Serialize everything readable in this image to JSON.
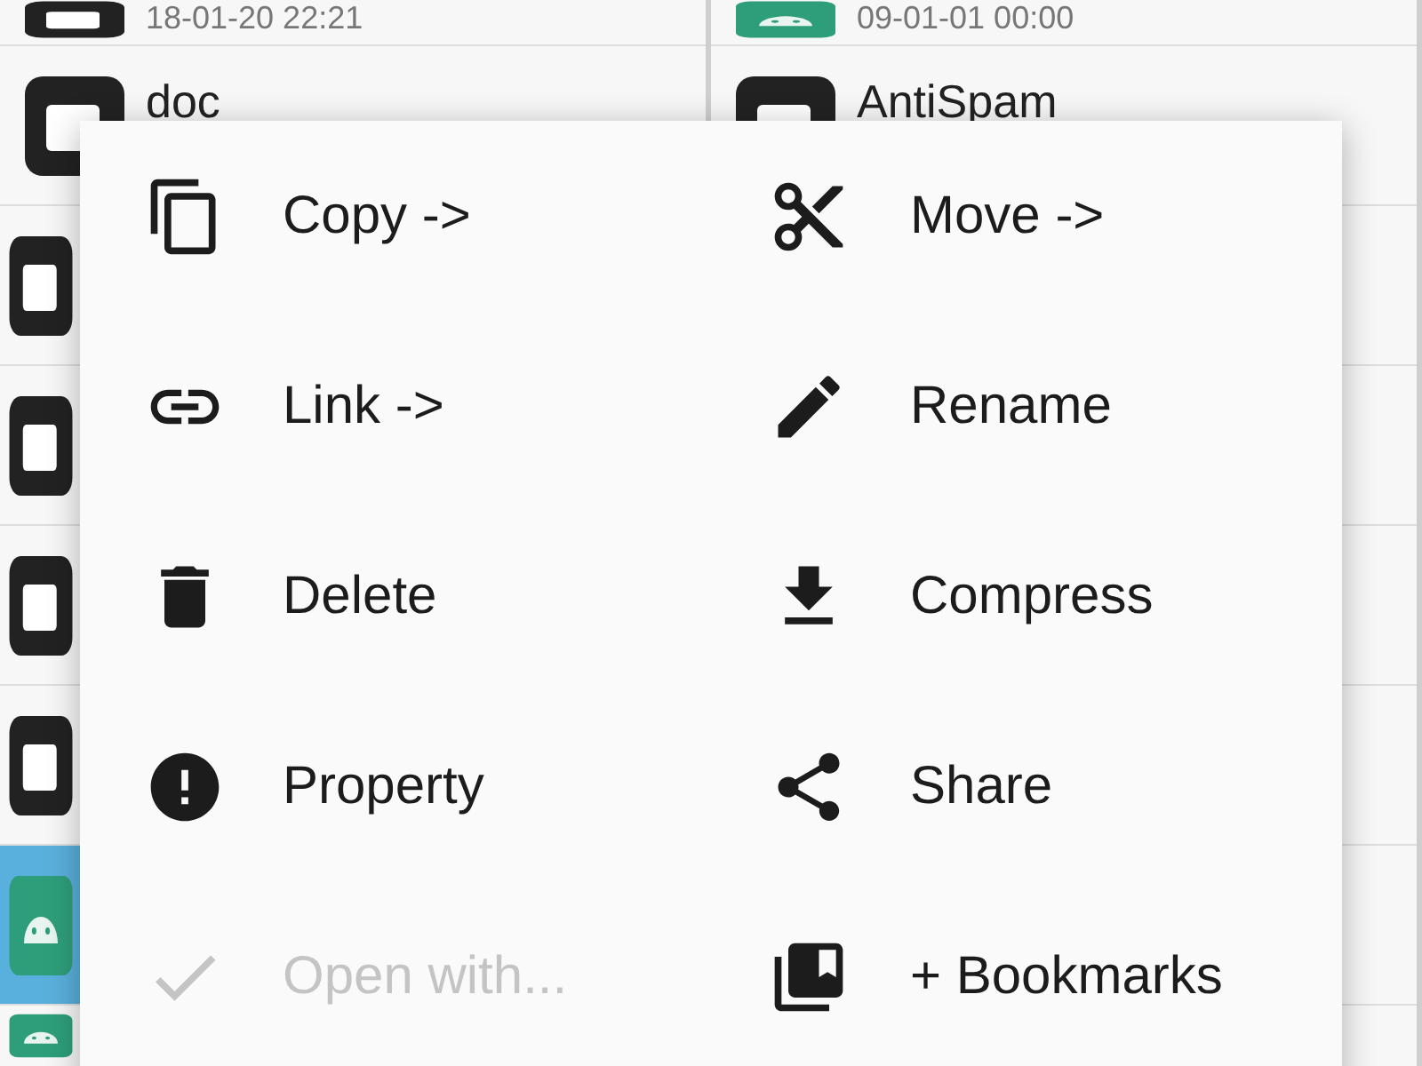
{
  "file_list": {
    "columns": [
      {
        "rows": [
          {
            "kind": "folder",
            "date": "18-01-20 22:21",
            "selected": false
          },
          {
            "kind": "folder",
            "name": "doc",
            "selected": false
          },
          {
            "kind": "folder",
            "selected": false
          },
          {
            "kind": "folder",
            "selected": false
          },
          {
            "kind": "folder",
            "selected": false
          },
          {
            "kind": "folder",
            "selected": false
          },
          {
            "kind": "app",
            "selected": true
          },
          {
            "kind": "app",
            "selected": false
          }
        ]
      },
      {
        "rows": [
          {
            "kind": "app",
            "date": "09-01-01 00:00",
            "selected": false
          },
          {
            "kind": "folder",
            "name": "AntiSpam",
            "selected": false
          },
          {
            "kind": "blank",
            "selected": false
          },
          {
            "kind": "blank",
            "selected": false
          },
          {
            "kind": "blank",
            "selected": false
          },
          {
            "kind": "blank",
            "selected": false
          },
          {
            "kind": "blank",
            "selected": false
          },
          {
            "kind": "blank",
            "selected": false
          }
        ]
      }
    ]
  },
  "context_menu": {
    "items": [
      {
        "kind": "copy",
        "label": "Copy ->",
        "disabled": false
      },
      {
        "kind": "move",
        "label": "Move ->",
        "disabled": false
      },
      {
        "kind": "link",
        "label": "Link ->",
        "disabled": false
      },
      {
        "kind": "rename",
        "label": "Rename",
        "disabled": false
      },
      {
        "kind": "delete",
        "label": "Delete",
        "disabled": false
      },
      {
        "kind": "compress",
        "label": "Compress",
        "disabled": false
      },
      {
        "kind": "property",
        "label": "Property",
        "disabled": false
      },
      {
        "kind": "share",
        "label": "Share",
        "disabled": false
      },
      {
        "kind": "open",
        "label": "Open with...",
        "disabled": true
      },
      {
        "kind": "bookmark",
        "label": "+ Bookmarks",
        "disabled": false
      }
    ]
  }
}
